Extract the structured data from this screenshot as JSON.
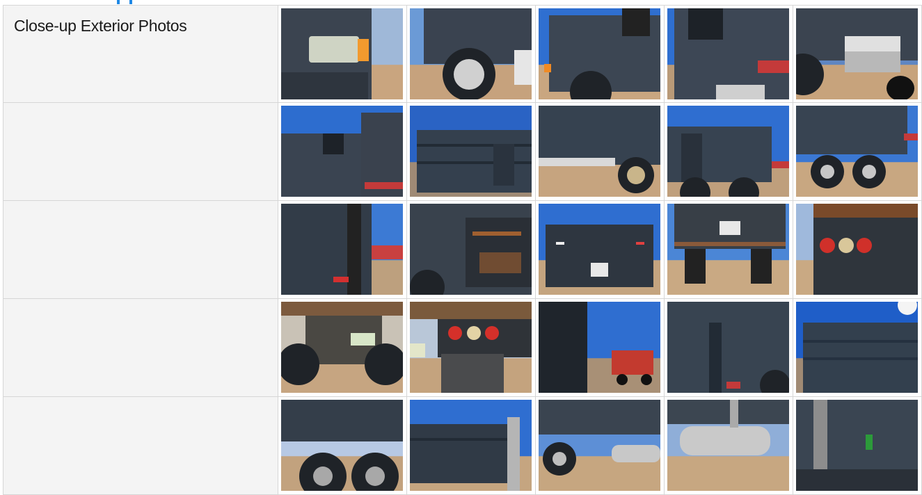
{
  "section": {
    "title": "Close-up Exterior Photos"
  },
  "rows": [
    {
      "label": "Close-up Exterior Photos",
      "photos": [
        {
          "subject": "headlight",
          "sky": "#9fb8d8",
          "ground": "#c9a57f",
          "body": "#3b4450",
          "accent": "#f29a2e"
        },
        {
          "subject": "front-wheel",
          "sky": "#6b9ad6",
          "ground": "#c6a27d",
          "body": "#3a4350",
          "accent": "#d0d0d0"
        },
        {
          "subject": "cab-side",
          "sky": "#2f6fd0",
          "ground": "#c9a680",
          "body": "#3c4653",
          "accent": "#f08a24"
        },
        {
          "subject": "door",
          "sky": "#2f6fd0",
          "ground": "#b99a78",
          "body": "#3d4755",
          "accent": "#c43a3a"
        },
        {
          "subject": "fuel-step",
          "sky": "#5f86c2",
          "ground": "#c7a37c",
          "body": "#3b4450",
          "accent": "#e0e0e0"
        }
      ]
    },
    {
      "label": "",
      "photos": [
        {
          "subject": "cab-mirror",
          "sky": "#2d6dcf",
          "ground": "#b9987a",
          "body": "#3a4451",
          "accent": "#c43a3a"
        },
        {
          "subject": "dump-bed",
          "sky": "#2a63c4",
          "ground": "#9f8a75",
          "body": "#34404e",
          "accent": "#b0b0b0"
        },
        {
          "subject": "bed-rear-wheels",
          "sky": "#2e6dd0",
          "ground": "#c6a47f",
          "body": "#364250",
          "accent": "#d9d9d9"
        },
        {
          "subject": "bed-side",
          "sky": "#2f6ed0",
          "ground": "#bf9f7c",
          "body": "#374351",
          "accent": "#c43a3a"
        },
        {
          "subject": "rear-axles",
          "sky": "#3b78d3",
          "ground": "#c8a781",
          "body": "#384452",
          "accent": "#c43a3a"
        }
      ]
    },
    {
      "label": "",
      "photos": [
        {
          "subject": "tailgate-hinge",
          "sky": "#3c7ad4",
          "ground": "#bda07e",
          "body": "#323c48",
          "accent": "#d33030"
        },
        {
          "subject": "rusty-corner",
          "sky": "#4f89d8",
          "ground": "#9b8470",
          "body": "#39424d",
          "accent": "#a06030"
        },
        {
          "subject": "tailgate",
          "sky": "#2f6ed0",
          "ground": "#c4a47f",
          "body": "#2e3640",
          "accent": "#e04040"
        },
        {
          "subject": "rear-view",
          "sky": "#4b86d6",
          "ground": "#c9a983",
          "body": "#383f47",
          "accent": "#8a5a3a"
        },
        {
          "subject": "tail-lights",
          "sky": "#9fb9dc",
          "ground": "#c9a983",
          "body": "#2f353c",
          "accent": "#d0302a"
        }
      ]
    },
    {
      "label": "",
      "photos": [
        {
          "subject": "hitch-plate",
          "sky": "#c9c2b6",
          "ground": "#c6a581",
          "body": "#4a4843",
          "accent": "#d8e6c8"
        },
        {
          "subject": "lights-plate",
          "sky": "#b9c7d8",
          "ground": "#c4a37e",
          "body": "#7a5a3c",
          "accent": "#d5302a"
        },
        {
          "subject": "side-atv",
          "sky": "#2f6ed0",
          "ground": "#a89076",
          "body": "#1f252c",
          "accent": "#c33a2f"
        },
        {
          "subject": "bed-hinge",
          "sky": "#3975d3",
          "ground": "#b29677",
          "body": "#384451",
          "accent": "#c43a3a"
        },
        {
          "subject": "bed-sky",
          "sky": "#1f5ec8",
          "ground": "#a08a74",
          "body": "#33404e",
          "accent": "#f4f4f4"
        }
      ]
    },
    {
      "label": "",
      "photos": [
        {
          "subject": "rear-tires",
          "sky": "#b7c9e4",
          "ground": "#c2a27e",
          "body": "#343e4a",
          "accent": "#a8a8a8"
        },
        {
          "subject": "bed-stack",
          "sky": "#2f6ed0",
          "ground": "#c5a580",
          "body": "#303a46",
          "accent": "#b5b5b5"
        },
        {
          "subject": "tank-wheel",
          "sky": "#5d8fd6",
          "ground": "#c6a680",
          "body": "#3a4450",
          "accent": "#c8c8c8"
        },
        {
          "subject": "fuel-tank",
          "sky": "#8faed8",
          "ground": "#c7a781",
          "body": "#3c4651",
          "accent": "#c9c9c9"
        },
        {
          "subject": "cab-rear",
          "sky": "#2f6ed0",
          "ground": "#b99c7b",
          "body": "#3a4552",
          "accent": "#2c9a3a"
        }
      ]
    }
  ]
}
